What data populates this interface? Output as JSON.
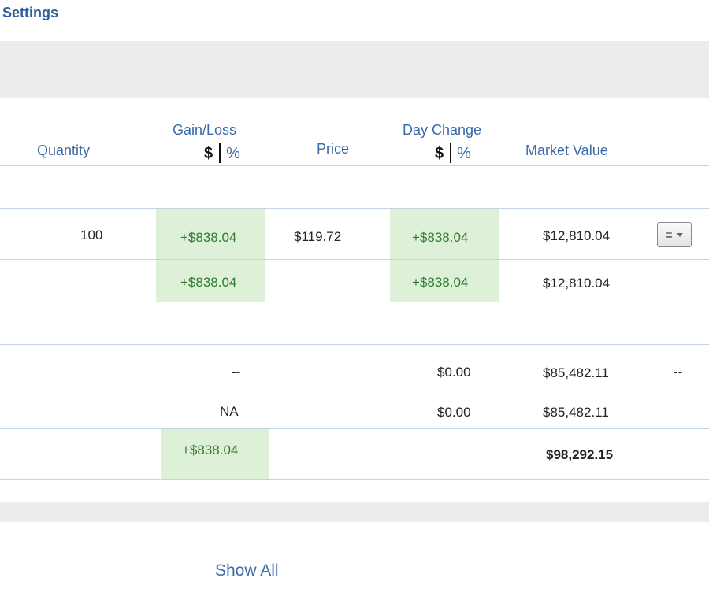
{
  "header": {
    "settings_label": "Settings"
  },
  "columns": {
    "quantity": "Quantity",
    "gain_loss": "Gain/Loss",
    "price": "Price",
    "day_change": "Day Change",
    "market_value": "Market Value",
    "dollar": "$",
    "percent": "%"
  },
  "rows": {
    "position": {
      "quantity": "100",
      "gain_loss": "+$838.04",
      "price": "$119.72",
      "day_change": "+$838.04",
      "market_value": "$12,810.04",
      "menu_icon": "hamburger-menu-icon"
    },
    "subtotal": {
      "gain_loss": "+$838.04",
      "day_change": "+$838.04",
      "market_value": "$12,810.04"
    },
    "cash_1": {
      "gain_loss": "--",
      "day_change": "$0.00",
      "market_value": "$85,482.11",
      "action": "--"
    },
    "cash_2": {
      "gain_loss": "NA",
      "day_change": "$0.00",
      "market_value": "$85,482.11"
    },
    "total": {
      "gain_loss": "+$838.04",
      "market_value": "$98,292.15"
    }
  },
  "footer": {
    "show_all_label": "Show All"
  },
  "colors": {
    "link_blue": "#3a6aa8",
    "gain_green": "#2e7d32",
    "gain_bg": "#dff0d8",
    "band_grey": "#ececec"
  }
}
